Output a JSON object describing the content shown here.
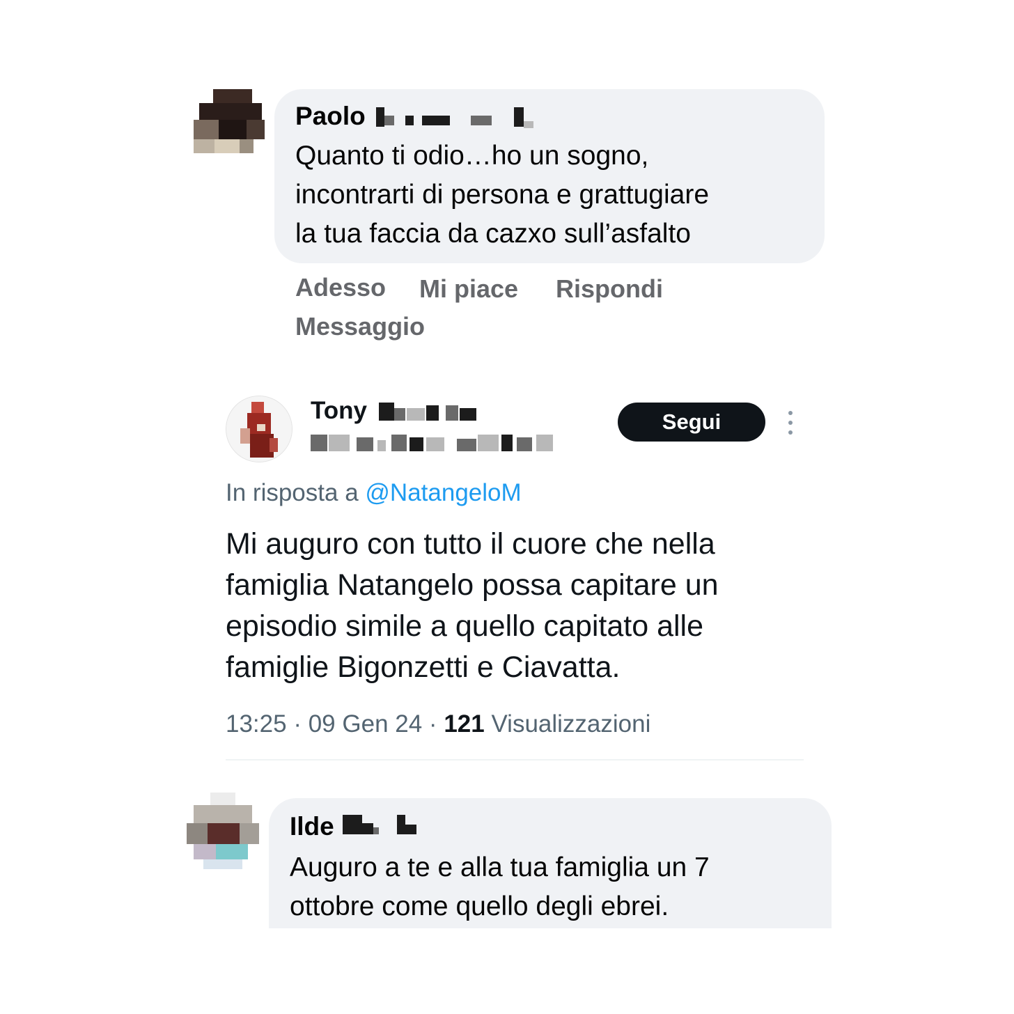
{
  "comment_1": {
    "author_first": "Paolo",
    "text": "Quanto ti odio…ho un sogno,\nincontrarti di persona e grattugiare\nla tua faccia da cazxo sull’asfalto",
    "actions": {
      "time": "Adesso",
      "like": "Mi piace",
      "reply": "Rispondi",
      "message": "Messaggio"
    }
  },
  "tweet": {
    "author_first": "Tony",
    "follow_label": "Segui",
    "reply_prefix": "In risposta a",
    "reply_mention": "@NatangeloM",
    "text": "Mi auguro con tutto il cuore che nella\nfamiglia Natangelo possa capitare un\nepisodio simile a quello capitato alle\nfamiglie Bigonzetti e Ciavatta.",
    "time": "13:25",
    "date": "09 Gen 24",
    "views_count": "121",
    "views_label": "Visualizzazioni",
    "icons": {
      "more": "more-vertical-icon"
    }
  },
  "comment_2": {
    "author_first": "Ilde",
    "text": "Auguro a te e alla tua famiglia un 7\nottobre come quello degli ebrei."
  },
  "colors": {
    "bubble": "#f0f2f5",
    "action_gray": "#65676b",
    "mention_blue": "#1d9bf0",
    "meta_gray": "#536471",
    "follow_bg": "#0f1419"
  }
}
